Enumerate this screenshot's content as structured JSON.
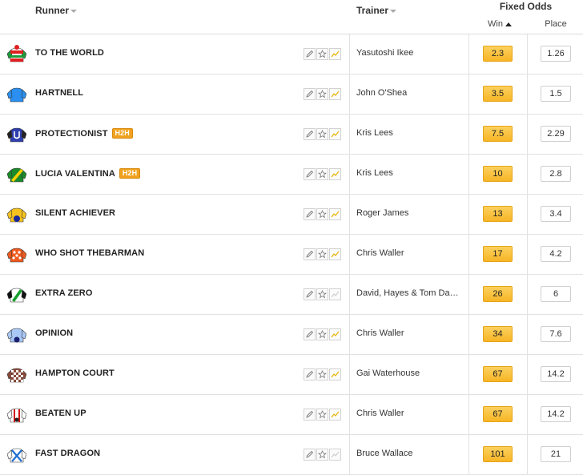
{
  "header": {
    "runner": "Runner",
    "trainer": "Trainer",
    "fixed_odds": "Fixed Odds",
    "win": "Win",
    "place": "Place"
  },
  "badge_label": "H2H",
  "runners": [
    {
      "name": "TO THE WORLD",
      "trainer": "Yasutoshi Ikee",
      "win": "2.3",
      "place": "1.26",
      "h2h": false,
      "form_active": true,
      "silk": "green-red-hoops",
      "colors": [
        "#1e9c3a",
        "#e02020",
        "#ffffff"
      ]
    },
    {
      "name": "HARTNELL",
      "trainer": "John O'Shea",
      "win": "3.5",
      "place": "1.5",
      "h2h": false,
      "form_active": true,
      "silk": "solid-blue",
      "colors": [
        "#2a8ff0",
        "#2a8ff0",
        "#2a8ff0"
      ]
    },
    {
      "name": "PROTECTIONIST",
      "trainer": "Kris Lees",
      "win": "7.5",
      "place": "2.29",
      "h2h": true,
      "form_active": true,
      "silk": "checked-blue-u",
      "colors": [
        "#2f3fb0",
        "#ffffff",
        "#222222"
      ]
    },
    {
      "name": "LUCIA VALENTINA",
      "trainer": "Kris Lees",
      "win": "10",
      "place": "2.8",
      "h2h": true,
      "form_active": true,
      "silk": "green-yellow-sash",
      "colors": [
        "#1a8a2a",
        "#f5d000",
        "#1a8a2a"
      ]
    },
    {
      "name": "SILENT ACHIEVER",
      "trainer": "Roger James",
      "win": "13",
      "place": "3.4",
      "h2h": false,
      "form_active": true,
      "silk": "yellow-blue-cap",
      "colors": [
        "#f6c21e",
        "#1a2a9a",
        "#f6c21e"
      ]
    },
    {
      "name": "WHO SHOT THEBARMAN",
      "trainer": "Chris Waller",
      "win": "17",
      "place": "4.2",
      "h2h": false,
      "form_active": true,
      "silk": "orange-white-spots",
      "colors": [
        "#f05a1e",
        "#ffffff",
        "#f05a1e"
      ]
    },
    {
      "name": "EXTRA ZERO",
      "trainer": "David, Hayes & Tom Dabernig",
      "win": "26",
      "place": "6",
      "h2h": false,
      "form_active": false,
      "silk": "black-green-sash",
      "colors": [
        "#111111",
        "#ffffff",
        "#18a030"
      ]
    },
    {
      "name": "OPINION",
      "trainer": "Chris Waller",
      "win": "34",
      "place": "7.6",
      "h2h": false,
      "form_active": true,
      "silk": "lightblue-navy-cap",
      "colors": [
        "#a9c8f5",
        "#1a2070",
        "#a9c8f5"
      ]
    },
    {
      "name": "HAMPTON COURT",
      "trainer": "Gai Waterhouse",
      "win": "67",
      "place": "14.2",
      "h2h": false,
      "form_active": true,
      "silk": "brown-white-check",
      "colors": [
        "#8b4a3a",
        "#ffffff",
        "#8b4a3a"
      ]
    },
    {
      "name": "BEATEN UP",
      "trainer": "Chris Waller",
      "win": "67",
      "place": "14.2",
      "h2h": false,
      "form_active": true,
      "silk": "white-red-stripes",
      "colors": [
        "#ffffff",
        "#d01010",
        "#222222"
      ]
    },
    {
      "name": "FAST DRAGON",
      "trainer": "Bruce Wallace",
      "win": "101",
      "place": "21",
      "h2h": false,
      "form_active": false,
      "silk": "white-blue-cross",
      "colors": [
        "#ffffff",
        "#1f6fd0",
        "#1f6fd0"
      ]
    }
  ]
}
